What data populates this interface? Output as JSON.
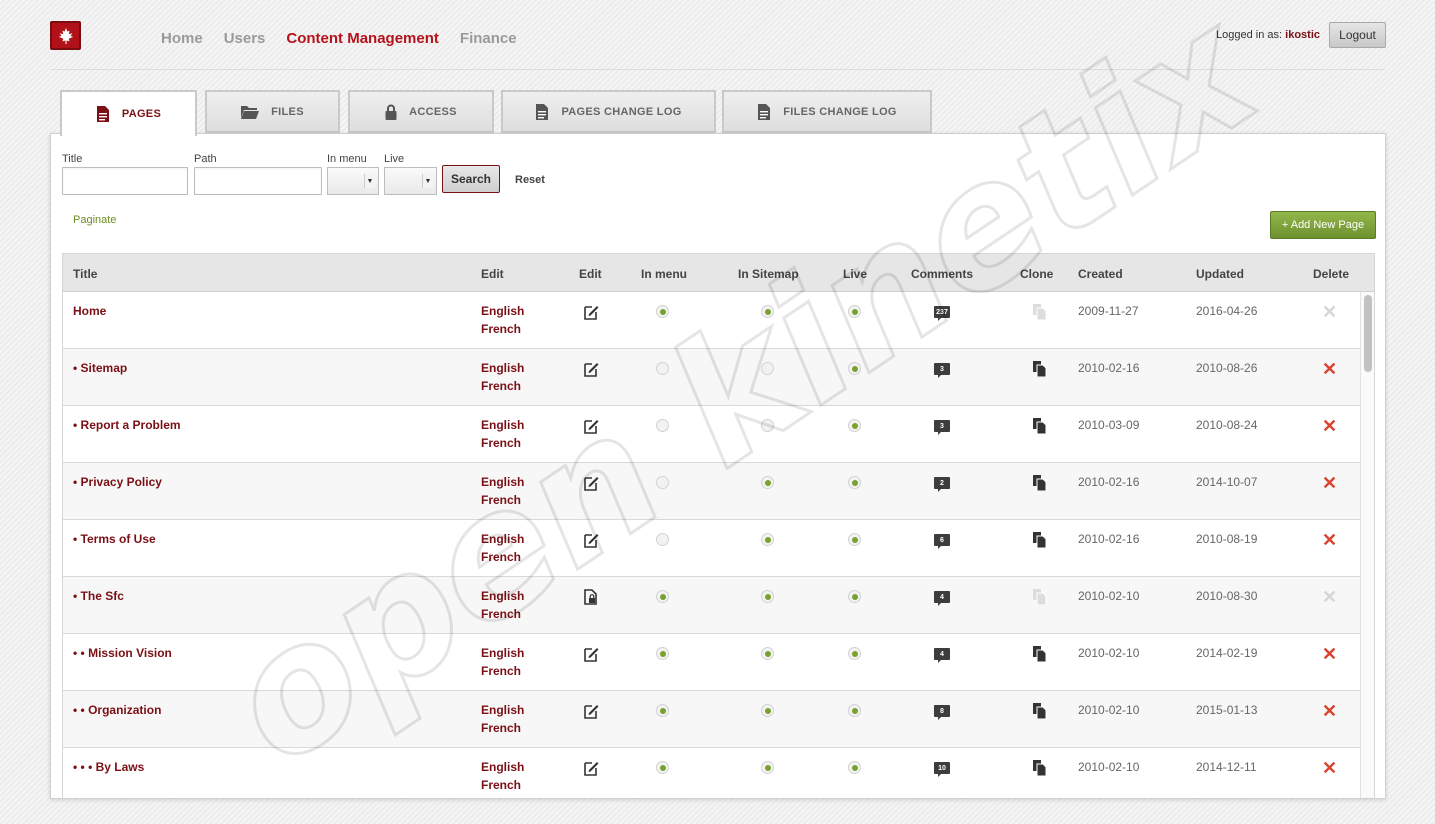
{
  "nav": {
    "items": [
      {
        "label": "Home",
        "active": false
      },
      {
        "label": "Users",
        "active": false
      },
      {
        "label": "Content Management",
        "active": true
      },
      {
        "label": "Finance",
        "active": false
      }
    ],
    "logged_in_label": "Logged in as:",
    "username": "ikostic",
    "logout_label": "Logout"
  },
  "tabs": [
    {
      "label": "PAGES",
      "icon": "document-icon",
      "active": true
    },
    {
      "label": "FILES",
      "icon": "folder-icon",
      "active": false
    },
    {
      "label": "ACCESS",
      "icon": "lock-icon",
      "active": false
    },
    {
      "label": "PAGES CHANGE LOG",
      "icon": "document-icon",
      "active": false
    },
    {
      "label": "FILES CHANGE LOG",
      "icon": "document-icon",
      "active": false
    }
  ],
  "filters": {
    "title_label": "Title",
    "title_value": "",
    "path_label": "Path",
    "path_value": "",
    "in_menu_label": "In menu",
    "live_label": "Live",
    "search_label": "Search",
    "reset_label": "Reset"
  },
  "paginate_label": "Paginate",
  "add_page_label": "+ Add New Page",
  "columns": [
    "Title",
    "Edit",
    "Edit",
    "In menu",
    "In Sitemap",
    "Live",
    "Comments",
    "Clone",
    "Created",
    "Updated",
    "Delete"
  ],
  "rows": [
    {
      "title": "Home",
      "lang1": "English",
      "lang2": "French",
      "locked": false,
      "in_menu": true,
      "in_sitemap": true,
      "live": true,
      "comments": "237",
      "clone_enabled": false,
      "created": "2009-11-27",
      "updated": "2016-04-26",
      "delete_enabled": false
    },
    {
      "title": "• Sitemap",
      "lang1": "English",
      "lang2": "French",
      "locked": false,
      "in_menu": false,
      "in_sitemap": false,
      "live": true,
      "comments": "3",
      "clone_enabled": true,
      "created": "2010-02-16",
      "updated": "2010-08-26",
      "delete_enabled": true
    },
    {
      "title": "• Report a Problem",
      "lang1": "English",
      "lang2": "French",
      "locked": false,
      "in_menu": false,
      "in_sitemap": false,
      "live": true,
      "comments": "3",
      "clone_enabled": true,
      "created": "2010-03-09",
      "updated": "2010-08-24",
      "delete_enabled": true
    },
    {
      "title": "• Privacy Policy",
      "lang1": "English",
      "lang2": "French",
      "locked": false,
      "in_menu": false,
      "in_sitemap": true,
      "live": true,
      "comments": "2",
      "clone_enabled": true,
      "created": "2010-02-16",
      "updated": "2014-10-07",
      "delete_enabled": true
    },
    {
      "title": "• Terms of Use",
      "lang1": "English",
      "lang2": "French",
      "locked": false,
      "in_menu": false,
      "in_sitemap": true,
      "live": true,
      "comments": "6",
      "clone_enabled": true,
      "created": "2010-02-16",
      "updated": "2010-08-19",
      "delete_enabled": true
    },
    {
      "title": "• The Sfc",
      "lang1": "English",
      "lang2": "French",
      "locked": true,
      "in_menu": true,
      "in_sitemap": true,
      "live": true,
      "comments": "4",
      "clone_enabled": false,
      "created": "2010-02-10",
      "updated": "2010-08-30",
      "delete_enabled": false
    },
    {
      "title": "• • Mission Vision",
      "lang1": "English",
      "lang2": "French",
      "locked": false,
      "in_menu": true,
      "in_sitemap": true,
      "live": true,
      "comments": "4",
      "clone_enabled": true,
      "created": "2010-02-10",
      "updated": "2014-02-19",
      "delete_enabled": true
    },
    {
      "title": "• • Organization",
      "lang1": "English",
      "lang2": "French",
      "locked": false,
      "in_menu": true,
      "in_sitemap": true,
      "live": true,
      "comments": "8",
      "clone_enabled": true,
      "created": "2010-02-10",
      "updated": "2015-01-13",
      "delete_enabled": true
    },
    {
      "title": "• • • By Laws",
      "lang1": "English",
      "lang2": "French",
      "locked": false,
      "in_menu": true,
      "in_sitemap": true,
      "live": true,
      "comments": "10",
      "clone_enabled": true,
      "created": "2010-02-10",
      "updated": "2014-12-11",
      "delete_enabled": true
    }
  ],
  "watermark": "open kinetix",
  "colors": {
    "brand": "#b5121b",
    "title": "#7a1016",
    "green": "#79a12d",
    "delete": "#d9432f"
  }
}
